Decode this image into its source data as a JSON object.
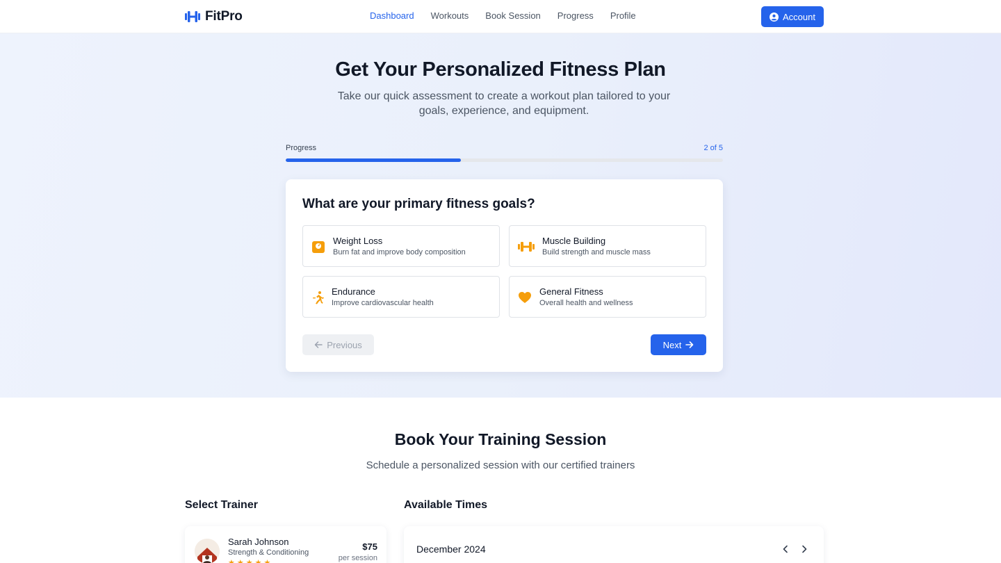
{
  "brand": {
    "name": "FitPro"
  },
  "nav": {
    "links": [
      {
        "label": "Dashboard",
        "active": true
      },
      {
        "label": "Workouts",
        "active": false
      },
      {
        "label": "Book Session",
        "active": false
      },
      {
        "label": "Progress",
        "active": false
      },
      {
        "label": "Profile",
        "active": false
      }
    ],
    "account_label": "Account"
  },
  "hero": {
    "title": "Get Your Personalized Fitness Plan",
    "subtitle": "Take our quick assessment to create a workout plan tailored to your goals, experience, and equipment."
  },
  "progress": {
    "label": "Progress",
    "step_text": "2 of 5",
    "current": 2,
    "total": 5
  },
  "assessment": {
    "question": "What are your primary fitness goals?",
    "goals": [
      {
        "title": "Weight Loss",
        "description": "Burn fat and improve body composition",
        "icon": "scale-icon"
      },
      {
        "title": "Muscle Building",
        "description": "Build strength and muscle mass",
        "icon": "dumbbell-icon"
      },
      {
        "title": "Endurance",
        "description": "Improve cardiovascular health",
        "icon": "running-icon"
      },
      {
        "title": "General Fitness",
        "description": "Overall health and wellness",
        "icon": "heart-icon"
      }
    ],
    "previous_label": "Previous",
    "next_label": "Next"
  },
  "booking": {
    "title": "Book Your Training Session",
    "subtitle": "Schedule a personalized session with our certified trainers",
    "select_trainer_label": "Select Trainer",
    "available_times_label": "Available Times",
    "trainer": {
      "name": "Sarah Johnson",
      "specialty": "Strength & Conditioning",
      "price": "$75",
      "price_unit": "per session",
      "stars": "★★★★★"
    },
    "calendar": {
      "month": "December 2024"
    }
  },
  "colors": {
    "accent": "#2563eb",
    "icon_orange": "#f59e0b"
  }
}
